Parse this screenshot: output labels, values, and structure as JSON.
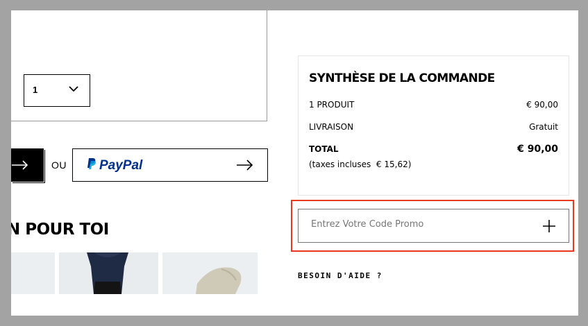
{
  "product": {
    "quantity": "1"
  },
  "checkout": {
    "or_label": "OU",
    "paypal_label": "PayPal"
  },
  "recommendations": {
    "title": "N POUR TOI"
  },
  "summary": {
    "title": "SYNTHÈSE DE LA COMMANDE",
    "rows": [
      {
        "label": "1 PRODUIT",
        "value": "€ 90,00"
      },
      {
        "label": "LIVRAISON",
        "value": "Gratuit"
      }
    ],
    "total_label": "TOTAL",
    "total_value": "€ 90,00",
    "tax_note": "(taxes incluses  € 15,62)"
  },
  "promo": {
    "placeholder": "Entrez Votre Code Promo"
  },
  "help": {
    "label": "BESOIN D'AIDE ?"
  },
  "colors": {
    "highlight": "#e8391f",
    "paypal_dark": "#003087",
    "paypal_light": "#009cde"
  }
}
